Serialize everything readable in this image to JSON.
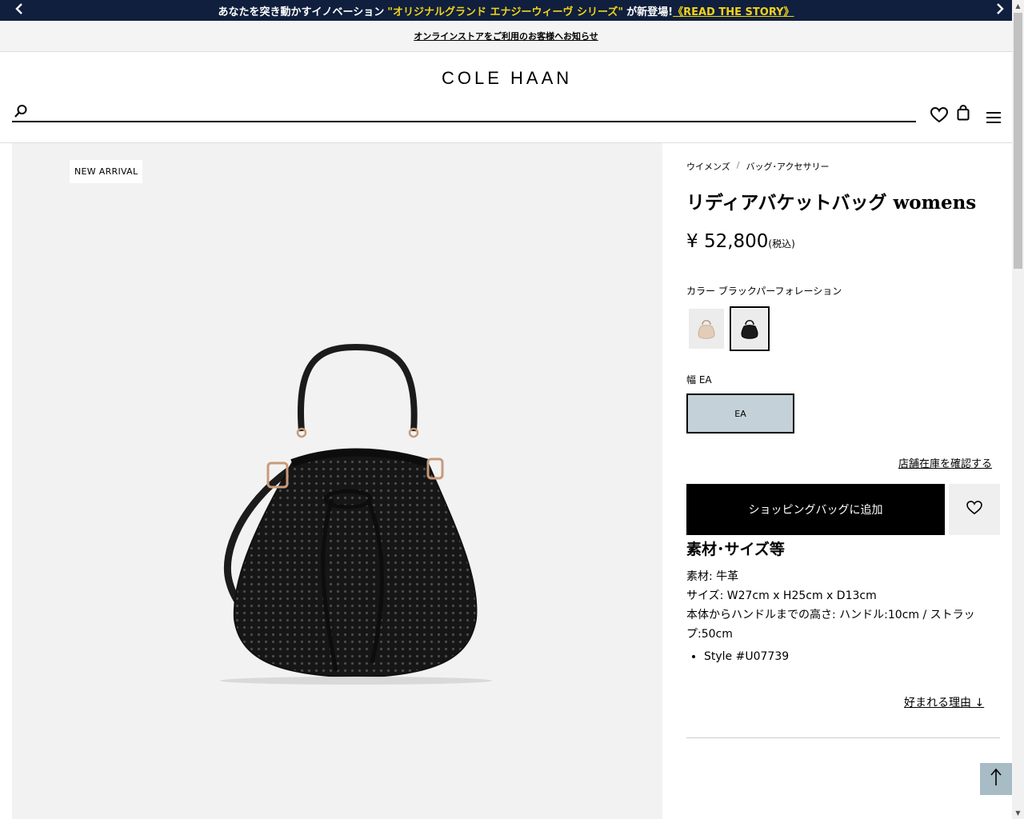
{
  "promo": {
    "text_before": "あなたを突き動かすイノベーション",
    "highlight": "\"オリジナルグランド エナジーウィーヴ シリーズ\"",
    "text_after": "が新登場!",
    "link": "《READ THE STORY》"
  },
  "notice": {
    "link": "オンラインストアをご利用のお客様へお知らせ"
  },
  "header": {
    "logo": "COLE HAAN",
    "search_placeholder": "",
    "icons": [
      "search-icon",
      "heart-icon",
      "shopping-bag-icon",
      "menu-icon"
    ]
  },
  "gallery": {
    "badge": "NEW ARRIVAL"
  },
  "product": {
    "breadcrumb": [
      "ウイメンズ",
      "/",
      "バッグ･アクセサリー"
    ],
    "title": "リディアバケットバッグ womens",
    "price": "¥ 52,800",
    "tax_note": "(税込)",
    "color_label": "カラー ブラックパーフォレーション",
    "swatches": [
      "ivory-bag-swatch",
      "black-bag-swatch"
    ],
    "selected_swatch": 1,
    "width_label": "幅 EA",
    "size_option": "EA",
    "stock_link": "店舗在庫を確認する",
    "add_to_bag": "ショッピングバッグに追加",
    "spec_title": "素材･サイズ等",
    "spec_material": "素材: 牛革",
    "spec_size": "サイズ: W27cm x H25cm x D13cm",
    "spec_height": "本体からハンドルまでの高さ: ハンドル:10cm / ストラップ:50cm",
    "style_number": "Style #U07739",
    "reason_link": "好まれる理由",
    "reason_arrow": "↓"
  },
  "colors": {
    "promo_bg": "#0f1f3d",
    "promo_highlight": "#f2d21b",
    "size_selected_bg": "#c5d1d8",
    "to_top_bg": "#a8bcc6"
  }
}
